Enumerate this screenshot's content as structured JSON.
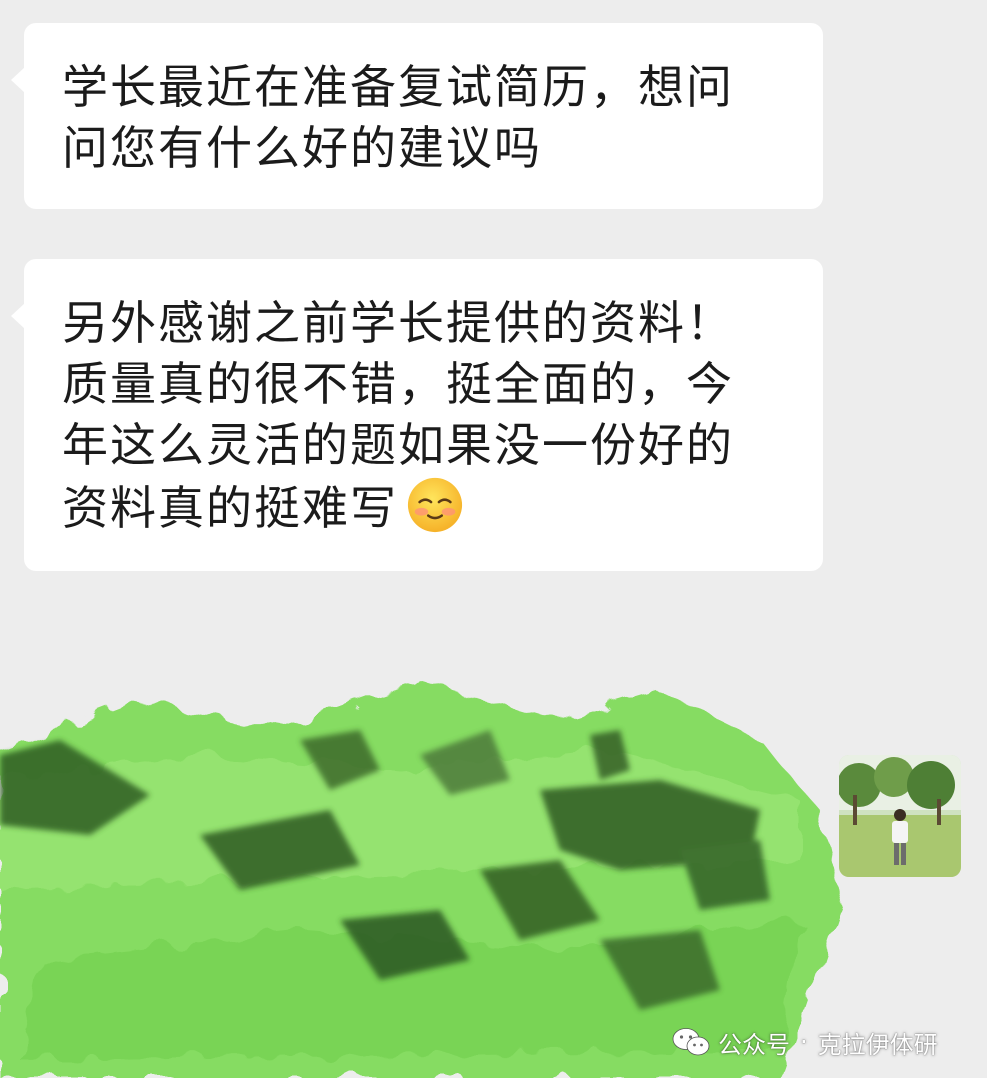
{
  "colors": {
    "chat_background": "#ededed",
    "bubble_background": "#ffffff",
    "message_text": "#1b1b1b",
    "scribble_green": "#7fd85a"
  },
  "messages": [
    {
      "lines": [
        "学长最近在准备复试简历，想问",
        "问您有什么好的建议吗"
      ]
    },
    {
      "lines": [
        "另外感谢之前学长提供的资料！",
        "质量真的很不错，挺全面的，今",
        "年这么灵活的题如果没一份好的",
        "资料真的挺难写"
      ],
      "trailing_emoji": "smiling-face-with-blush"
    }
  ],
  "avatar": {
    "icon": "profile-photo-park"
  },
  "watermark": {
    "icon": "wechat-icon",
    "label": "公众号",
    "separator": "·",
    "account": "克拉伊体研"
  }
}
